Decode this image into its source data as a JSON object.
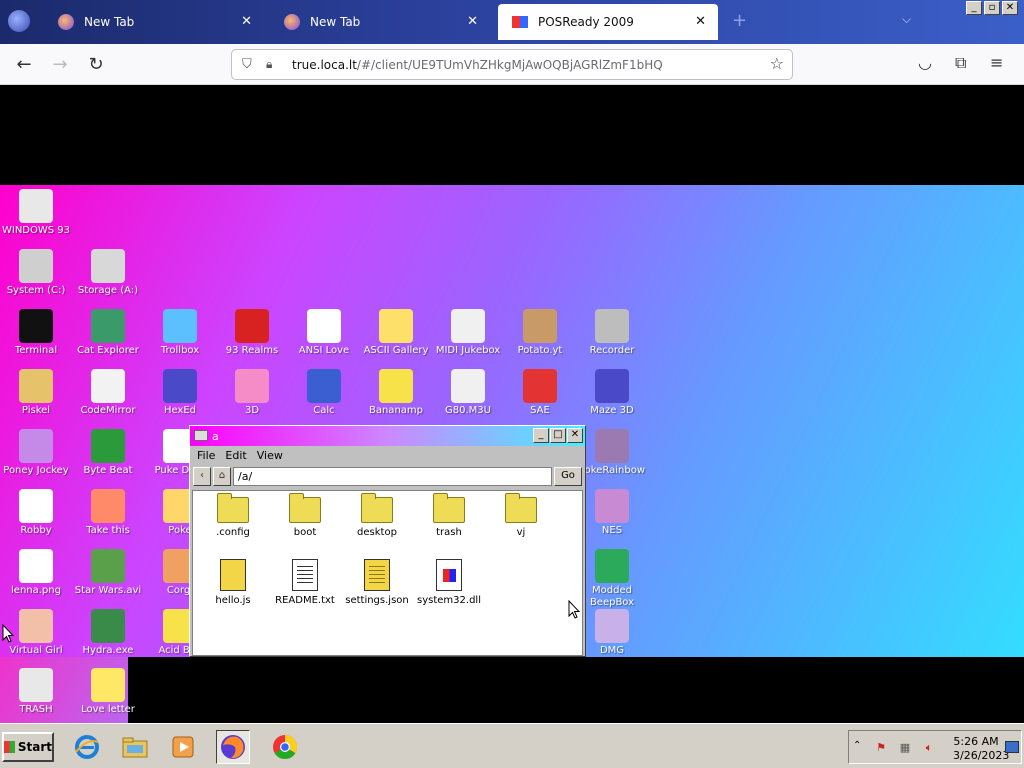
{
  "browser": {
    "tabs": [
      {
        "label": "New Tab",
        "close": "✕"
      },
      {
        "label": "New Tab",
        "close": "✕"
      },
      {
        "label": "POSReady 2009",
        "close": "✕"
      }
    ],
    "new_tab": "+",
    "tab_list": "⌵",
    "url_host": "true.loca.lt",
    "url_path": "/#/client/UE9TUmVhZHkgMjAwOQBjAGRlZmF1bHQ",
    "window_buttons": [
      "_",
      "▫",
      "✕"
    ]
  },
  "desktop": {
    "icons": [
      {
        "label": "WINDOWS 93",
        "icon": "computer-icon",
        "color": "#e8e8e8"
      },
      {
        "label": "System (C:)",
        "icon": "drive-icon",
        "color": "#cfcfcf"
      },
      {
        "label": "Storage (A:)",
        "icon": "floppy-drive-icon",
        "color": "#d8d8d8"
      },
      {
        "label": "Terminal",
        "icon": "terminal-icon",
        "color": "#111111"
      },
      {
        "label": "Cat Explorer",
        "icon": "globe-cat-icon",
        "color": "#3a9a6a"
      },
      {
        "label": "Trollbox",
        "icon": "chat-icon",
        "color": "#5cc0ff"
      },
      {
        "label": "93 Realms",
        "icon": "knight-icon",
        "color": "#d82222"
      },
      {
        "label": "ANSI Love",
        "icon": "letter-a-icon",
        "color": "#ffffff"
      },
      {
        "label": "ASCII Gallery",
        "icon": "numbers-icon",
        "color": "#fde06a"
      },
      {
        "label": "MIDI Jukebox",
        "icon": "piano-icon",
        "color": "#f0f0f0"
      },
      {
        "label": "Potato.yt",
        "icon": "potato-icon",
        "color": "#c89a68"
      },
      {
        "label": "Recorder",
        "icon": "microphone-icon",
        "color": "#bdbdbd"
      },
      {
        "label": "Piskel",
        "icon": "palette-icon",
        "color": "#e6c26a"
      },
      {
        "label": "CodeMirror",
        "icon": "codemirror-icon",
        "color": "#f2f2f2"
      },
      {
        "label": "HexEd",
        "icon": "hex-cube-icon",
        "color": "#4a4ac8"
      },
      {
        "label": "3D",
        "icon": "teapot-icon",
        "color": "#f58cc7"
      },
      {
        "label": "Calc",
        "icon": "calculator-icon",
        "color": "#3b5fd1"
      },
      {
        "label": "Bananamp",
        "icon": "banana-icon",
        "color": "#f7e24a"
      },
      {
        "label": "G80.M3U",
        "icon": "audio-file-icon",
        "color": "#f0f0f0"
      },
      {
        "label": "SAE",
        "icon": "amiga-ball-icon",
        "color": "#e33333"
      },
      {
        "label": "Maze 3D",
        "icon": "maze-icon",
        "color": "#4a4ac8"
      },
      {
        "label": "Poney Jockey",
        "icon": "pony-icon",
        "color": "#c58ae8"
      },
      {
        "label": "Byte Beat",
        "icon": "bytebeat-icon",
        "color": "#2a9a3a"
      },
      {
        "label": "Puke Data",
        "icon": "pd-icon",
        "color": "#ffffff"
      },
      {
        "label": "PokeRainbow",
        "icon": "trainers-icon",
        "color": "#9a7ab0"
      },
      {
        "label": "Robby",
        "icon": "stick-figure-icon",
        "color": "#ffffff"
      },
      {
        "label": "Take this",
        "icon": "clown-icon",
        "color": "#ff8a6a"
      },
      {
        "label": "Poke",
        "icon": "poke-icon",
        "color": "#ffd66a"
      },
      {
        "label": "NES",
        "icon": "nes-icon",
        "color": "#c98ad4"
      },
      {
        "label": "lenna.png",
        "icon": "image-file-icon",
        "color": "#ffffff"
      },
      {
        "label": "Star Wars.avi",
        "icon": "yoda-icon",
        "color": "#5aa04a"
      },
      {
        "label": "Corgi",
        "icon": "corgi-icon",
        "color": "#f0a060"
      },
      {
        "label": "Modded BeepBox",
        "icon": "beepbox-icon",
        "color": "#2aaa5a"
      },
      {
        "label": "Virtual Girl",
        "icon": "girl-portrait-icon",
        "color": "#f2c0a8"
      },
      {
        "label": "Hydra.exe",
        "icon": "hydra-icon",
        "color": "#3a8a4a"
      },
      {
        "label": "Acid Box",
        "icon": "smiley-icon",
        "color": "#f7e24a"
      },
      {
        "label": "DMG",
        "icon": "dmg-icon",
        "color": "#c8b0e8"
      },
      {
        "label": "TRASH",
        "icon": "trash-icon",
        "color": "#e8e8e8"
      },
      {
        "label": "Love letter",
        "icon": "envelope-icon",
        "color": "#ffe866"
      }
    ]
  },
  "explorer": {
    "title": "a",
    "window_buttons": [
      "_",
      "□",
      "✕"
    ],
    "menu": [
      "File",
      "Edit",
      "View"
    ],
    "back": "‹",
    "home": "⌂",
    "path": "/a/",
    "go": "Go",
    "items": [
      {
        "label": ".config",
        "type": "folder"
      },
      {
        "label": "boot",
        "type": "folder"
      },
      {
        "label": "desktop",
        "type": "folder"
      },
      {
        "label": "trash",
        "type": "folder"
      },
      {
        "label": "vj",
        "type": "folder"
      },
      {
        "label": "hello.js",
        "type": "js"
      },
      {
        "label": "README.txt",
        "type": "txt"
      },
      {
        "label": "settings.json",
        "type": "json"
      },
      {
        "label": "system32.dll",
        "type": "dll"
      }
    ]
  },
  "taskbar": {
    "start": "Start",
    "apps": [
      "internet-explorer-icon",
      "windows-explorer-icon",
      "media-player-icon",
      "firefox-icon",
      "chrome-icon"
    ],
    "tray_toggle": "⌃",
    "time": "5:26 AM",
    "date": "3/26/2023"
  }
}
